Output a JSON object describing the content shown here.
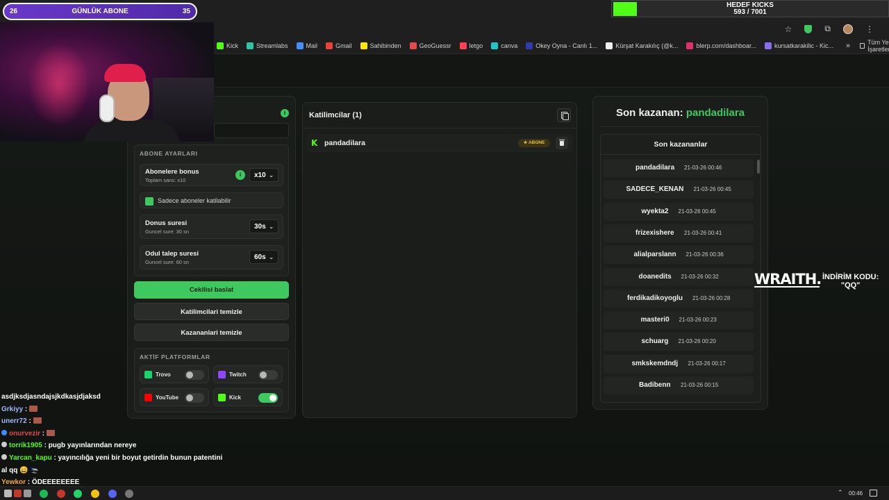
{
  "overlay": {
    "subs": {
      "left": "26",
      "label": "GÜNLÜK ABONE",
      "right": "35"
    },
    "kick_goal": {
      "title": "HEDEF KICKS",
      "value": "593 / 7001",
      "progress": 0.0847
    },
    "promo": {
      "brand": "WRAITH.",
      "line1": "İNDİRİM KODU:",
      "line2": "\"QQ\""
    }
  },
  "bookmarks": [
    {
      "label": "Kick",
      "color": "#53fc18"
    },
    {
      "label": "Streamlabs",
      "color": "#31c3a2"
    },
    {
      "label": "Mail",
      "color": "#4a8cff"
    },
    {
      "label": "Gmail",
      "color": "#ea4335"
    },
    {
      "label": "Sahibinden",
      "color": "#ffe800"
    },
    {
      "label": "GeoGuessr",
      "color": "#e04b4b"
    },
    {
      "label": "letgo",
      "color": "#ff3f55"
    },
    {
      "label": "canva",
      "color": "#20c4cb"
    },
    {
      "label": "Okey Oyna - Canlı 1...",
      "color": "#2f3bb0"
    },
    {
      "label": "Kürşat Karakılıç (@k...",
      "color": "#eeeeee"
    },
    {
      "label": "blerp.com/dashboar...",
      "color": "#e0306a"
    },
    {
      "label": "kursatkarakilic - Kic...",
      "color": "#8a6cf0"
    }
  ],
  "bookmarks_all": "Tüm Yer İşaretleri",
  "settings": {
    "section_title": "ABONE AYARLARI",
    "bonus": {
      "label": "Abonelere bonus",
      "sub": "Toplam sans: x10",
      "value": "x10"
    },
    "only_subs": "Sadece aboneler katilabilir",
    "donus": {
      "label": "Donus suresi",
      "sub": "Guncel sure: 30 sn",
      "value": "30s"
    },
    "odul": {
      "label": "Odul talep suresi",
      "sub": "Guncel sure: 60 sn",
      "value": "60s"
    },
    "start_btn": "Cekilisi baslat",
    "clear_participants": "Katilimcilari temizle",
    "clear_winners": "Kazananlari temizle",
    "platforms_title": "AKTİF PLATFORMLAR",
    "platforms": [
      {
        "name": "Trovo",
        "color": "#19d66b",
        "on": false
      },
      {
        "name": "Twitch",
        "color": "#9146ff",
        "on": false
      },
      {
        "name": "YouTube",
        "color": "#ff0000",
        "on": false
      },
      {
        "name": "Kick",
        "color": "#53fc18",
        "on": true
      }
    ]
  },
  "participants": {
    "title": "Katilimcilar (1)",
    "list": [
      {
        "name": "pandadilara",
        "badge": "★ ABONE"
      }
    ]
  },
  "winners": {
    "title_prefix": "Son kazanan: ",
    "latest": "pandadilara",
    "list_title": "Son kazananlar",
    "list": [
      {
        "name": "pandadilara",
        "time": "21-03-26 00:46"
      },
      {
        "name": "SADECE_KENAN",
        "time": "21-03-26 00:45"
      },
      {
        "name": "wyekta2",
        "time": "21-03-26 00:45"
      },
      {
        "name": "frizexishere",
        "time": "21-03-26 00:41"
      },
      {
        "name": "alialparslann",
        "time": "21-03-26 00:36"
      },
      {
        "name": "doanedits",
        "time": "21-03-26 00:32"
      },
      {
        "name": "ferdikadikoyoglu",
        "time": "21-03-26 00:28"
      },
      {
        "name": "masteri0",
        "time": "21-03-26 00:23"
      },
      {
        "name": "schuarg",
        "time": "21-03-26 00:20"
      },
      {
        "name": "smkskemdndj",
        "time": "21-03-26 00:17"
      },
      {
        "name": "Badibenn",
        "time": "21-03-26 00:15"
      }
    ]
  },
  "chat": {
    "l0": "asdjksdjasndajsjkdkasjdjaksd",
    "l1_user": "Grkiyy",
    "l2_user": "unerr72",
    "l3_user": "onurvezir",
    "l4_user": "torrik1905",
    "l4_msg": " : pugb yayınlarından nereye",
    "l5_user": "Yarcan_kapu",
    "l5_msg": " : yayıncılığa yeni bir boyut getirdin bunun patentini",
    "l6": "al qq 😄 🛬",
    "l7_user": "Yewkor",
    "l7_msg": " : ÖDEEEEEEEE",
    "sep": " : "
  },
  "taskbar": {
    "time": "00:46"
  }
}
